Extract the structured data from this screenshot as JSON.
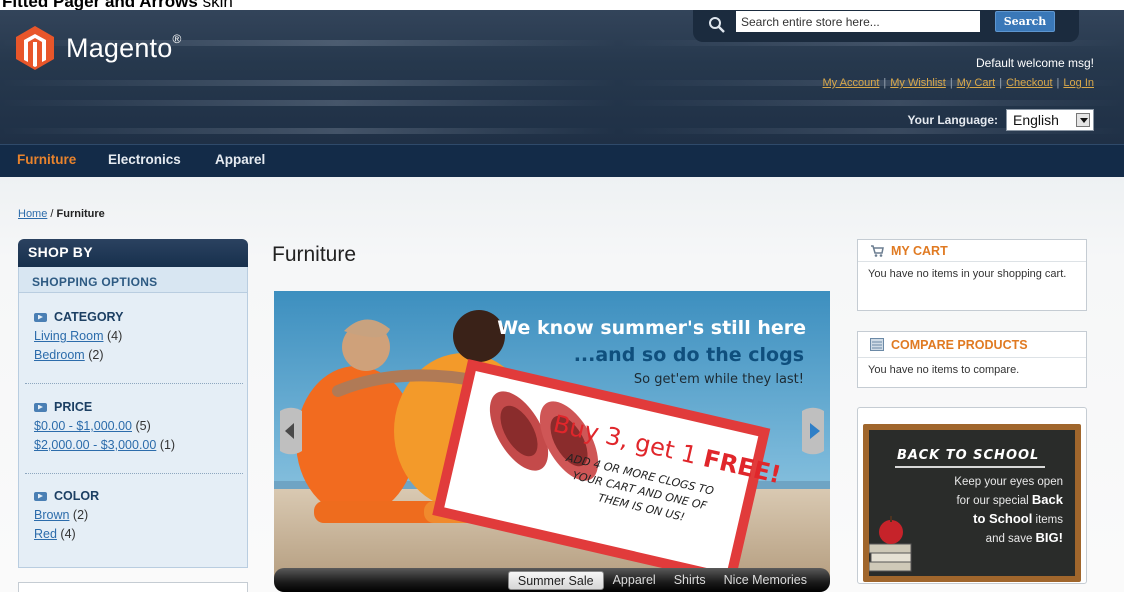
{
  "caption": {
    "bold": "Fitted Pager and Arrows",
    "rest": "skin"
  },
  "header": {
    "logo_text": "Magento",
    "logo_reg": "®",
    "search": {
      "value": "Search entire store here...",
      "button": "Search"
    },
    "welcome": "Default welcome msg!",
    "quicklinks": [
      "My Account",
      "My Wishlist",
      "My Cart",
      "Checkout",
      "Log In"
    ],
    "language": {
      "label": "Your Language:",
      "value": "English"
    }
  },
  "nav": {
    "items": [
      "Furniture",
      "Electronics",
      "Apparel"
    ],
    "active": "Furniture"
  },
  "breadcrumb": {
    "home": "Home",
    "sep": " / ",
    "current": "Furniture"
  },
  "sidebar": {
    "title": "SHOP BY",
    "subtitle": "SHOPPING OPTIONS",
    "groups": [
      {
        "name": "CATEGORY",
        "items": [
          {
            "label": "Living Room",
            "count": "(4)"
          },
          {
            "label": "Bedroom",
            "count": "(2)"
          }
        ]
      },
      {
        "name": "PRICE",
        "items": [
          {
            "label": "$0.00 - $1,000.00",
            "count": "(5)"
          },
          {
            "label": "$2,000.00 - $3,000.00",
            "count": "(1)"
          }
        ]
      },
      {
        "name": "COLOR",
        "items": [
          {
            "label": "Brown",
            "count": "(2)"
          },
          {
            "label": "Red",
            "count": "(4)"
          }
        ]
      }
    ]
  },
  "main": {
    "title": "Furniture",
    "banner": {
      "line1": "We know summer's still here",
      "line2": "...and so do the clogs",
      "line3": "So get'em while they last!",
      "deal_a": "Buy 3, get 1 ",
      "deal_b": "FREE!",
      "deal_c1": "ADD 4 OR MORE CLOGS TO",
      "deal_c2": "YOUR CART AND ONE OF",
      "deal_c3": "THEM IS ON US!"
    },
    "pager_tabs": [
      "Summer Sale",
      "Apparel",
      "Shirts",
      "Nice Memories"
    ],
    "pager_active": "Summer Sale"
  },
  "right": {
    "cart": {
      "title": "MY CART",
      "body": "You have no items in your shopping cart."
    },
    "compare": {
      "title": "COMPARE PRODUCTS",
      "body": "You have no items to compare."
    },
    "promo": {
      "heading": "BACK TO SCHOOL",
      "l1": "Keep your eyes open",
      "l2a": "for our special ",
      "l2b": "Back",
      "l3a": "to School",
      "l3b": " items",
      "l4a": "and save ",
      "l4b": "BIG!"
    }
  },
  "colors": {
    "accent": "#e07a22",
    "nav_bg": "#132b48",
    "link": "#2c6cab",
    "logo": "#e8562a"
  }
}
